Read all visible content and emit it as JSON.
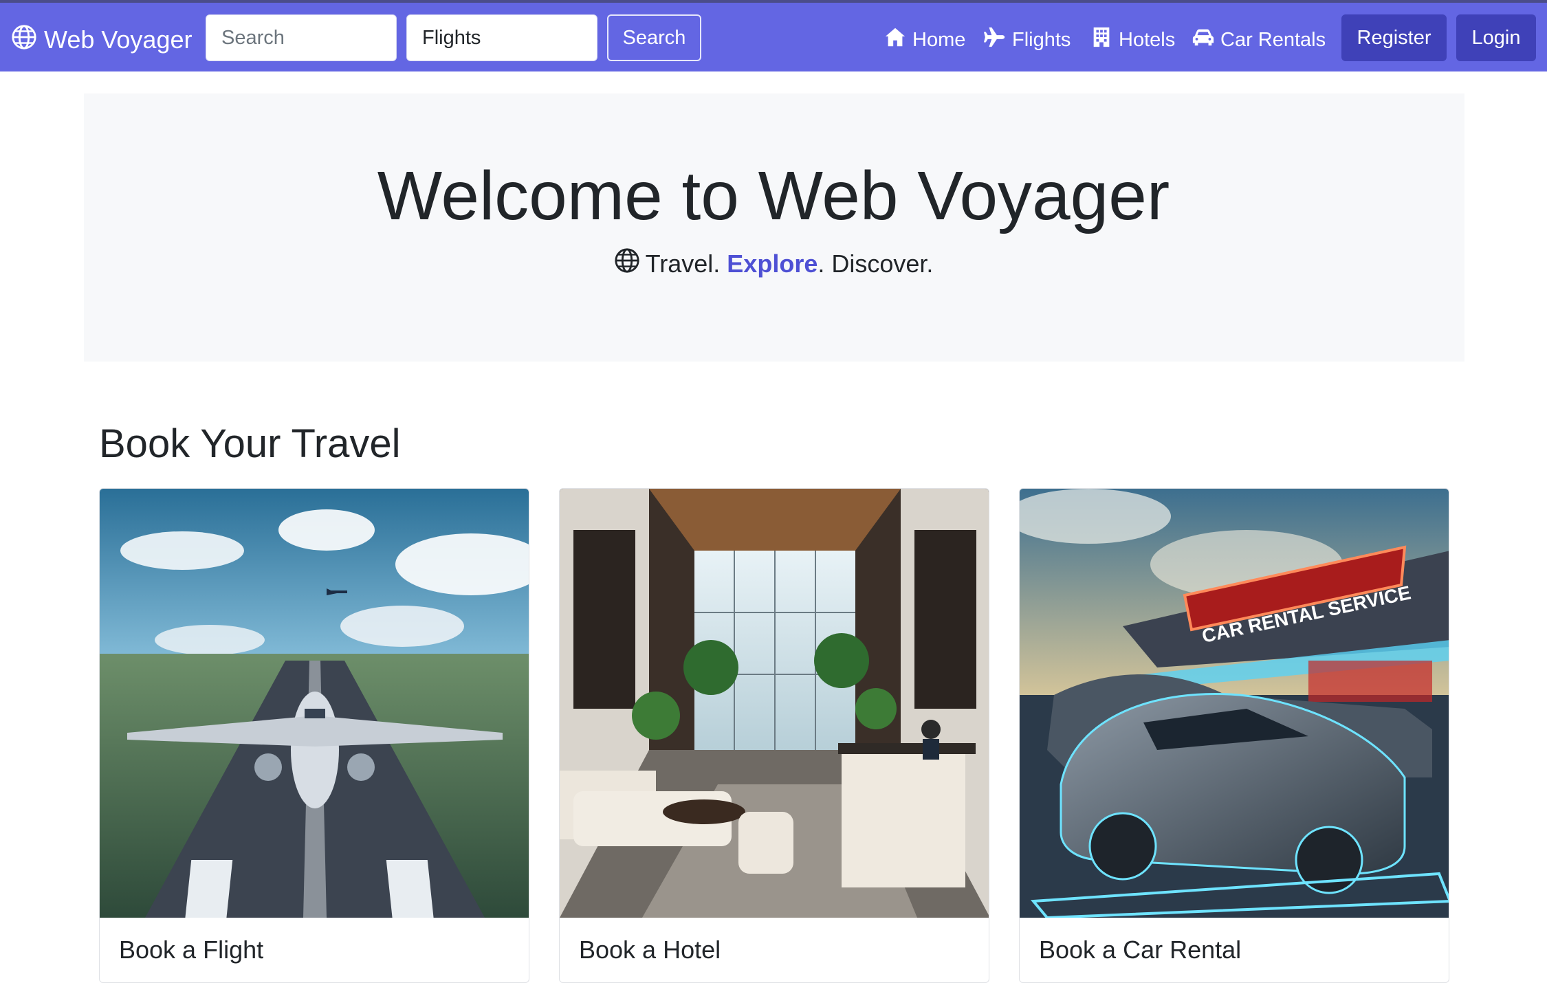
{
  "navbar": {
    "brand": "Web Voyager",
    "search_placeholder": "Search",
    "category_value": "Flights",
    "search_button": "Search",
    "links": [
      "Home",
      "Flights",
      "Hotels",
      "Car Rentals"
    ],
    "register": "Register",
    "login": "Login",
    "color": "#6366e3"
  },
  "hero": {
    "title": "Welcome to Web Voyager",
    "tagline_part1": "Travel.",
    "tagline_highlight": "Explore",
    "tagline_part2": ". Discover.",
    "accent_color": "#4e50d4"
  },
  "section": {
    "title": "Book Your Travel",
    "cards": [
      {
        "title": "Book a Flight",
        "image": "airplane-on-runway"
      },
      {
        "title": "Book a Hotel",
        "image": "hotel-lobby"
      },
      {
        "title": "Book a Car Rental",
        "image": "car-rental-service",
        "sign_text": "CAR RENTAL SERVICE"
      }
    ]
  }
}
